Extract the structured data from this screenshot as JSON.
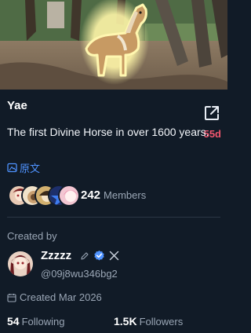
{
  "token": {
    "name": "Yae",
    "description": "The first Divine Horse in over 1600 years.",
    "age": "55d",
    "translate_label": "原文"
  },
  "community": {
    "member_count": "242",
    "members_label": "Members"
  },
  "creator": {
    "section_label": "Created by",
    "name": "Zzzzz",
    "handle": "@09j8wu346bg2",
    "created_date": "Created Mar 2026",
    "following_count": "54",
    "following_label": "Following",
    "followers_count": "1.5K",
    "followers_label": "Followers"
  },
  "colors": {
    "background": "#111b27",
    "accent_blue": "#4f93ff",
    "age_red": "#f0566e",
    "muted_text": "#9aa6b5"
  },
  "icons": [
    "external-link-icon",
    "translate-icon",
    "edit-pencil-icon",
    "verified-badge-icon",
    "x-logo-icon",
    "calendar-icon"
  ]
}
